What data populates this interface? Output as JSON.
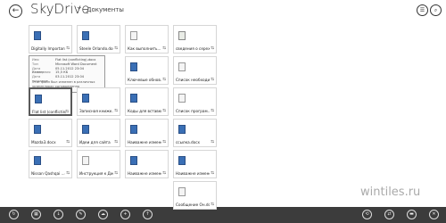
{
  "header": {
    "app_title": "SkyDrive",
    "breadcrumb": "Документы"
  },
  "tiles": [
    {
      "name": "Digitally Important..."
    },
    {
      "name": "Steele Orlando.docx"
    },
    {
      "name": "Как выполнить..."
    },
    {
      "name": "сведения о сереже..."
    },
    {
      "name": "..."
    },
    {
      "name": "..."
    },
    {
      "name": "..."
    },
    {
      "name": "Ключевые обнов..."
    },
    {
      "name": "Список необходи..."
    },
    {
      "name": "Flat list (conflicting)..."
    },
    {
      "name": "Записная книжк..."
    },
    {
      "name": "Коды для вставки"
    },
    {
      "name": "Список програм..."
    },
    {
      "name": "Mazda3.docx"
    },
    {
      "name": "Идеи для сайта"
    },
    {
      "name": "Наиважне изменении..."
    },
    {
      "name": "ссылка.docx"
    },
    {
      "name": "Nissan Qashqai ...ов..."
    },
    {
      "name": "Инструкция к Дис..."
    },
    {
      "name": "Наиважне изменения..."
    },
    {
      "name": "Наиважне изменения..."
    },
    {
      "name": "Сообщение Он.docx"
    }
  ],
  "tooltip": {
    "rows": [
      {
        "k": "Имя",
        "v": "Flat list (conflicting).docx"
      },
      {
        "k": "Тип",
        "v": "Microsoft Word Document"
      },
      {
        "k": "Дата изменения",
        "v": "05.11.2012 23:04"
      },
      {
        "k": "Размер",
        "v": "15,5 КБ"
      },
      {
        "k": "Дата создания",
        "v": "03.11.2012 23:04"
      }
    ],
    "note": "Этот файл был изменен в различных экземплярах одновременно"
  },
  "watermark": "wintiles.ru",
  "icons": {
    "back": "back-arrow-icon",
    "share": "share-icon"
  }
}
